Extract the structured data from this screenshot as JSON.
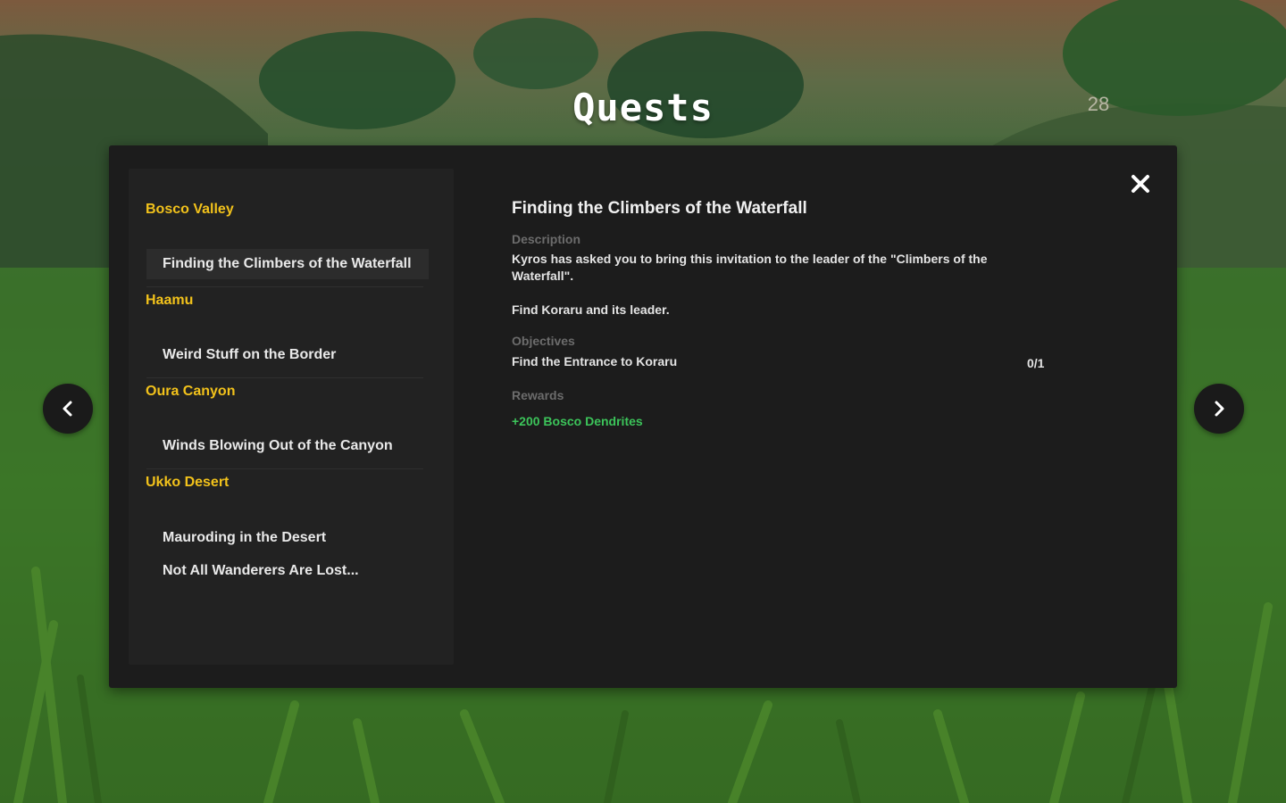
{
  "header": {
    "title": "Quests",
    "counter": "28"
  },
  "quest_list": {
    "regions": [
      {
        "name": "Bosco Valley",
        "quests": [
          {
            "title": "Finding the Climbers of the Waterfall",
            "selected": true
          }
        ]
      },
      {
        "name": "Haamu",
        "quests": [
          {
            "title": "Weird Stuff on the Border",
            "selected": false
          }
        ]
      },
      {
        "name": "Oura Canyon",
        "quests": [
          {
            "title": "Winds Blowing Out of the Canyon",
            "selected": false
          }
        ]
      },
      {
        "name": "Ukko Desert",
        "quests": [
          {
            "title": "Mauroding in the Desert",
            "selected": false
          },
          {
            "title": "Not All Wanderers Are Lost...",
            "selected": false
          }
        ]
      }
    ]
  },
  "detail": {
    "title": "Finding the Climbers of the Waterfall",
    "description_label": "Description",
    "description_lines": [
      "Kyros has asked you to bring this invitation to the leader of the \"Climbers of the",
      "Waterfall\"."
    ],
    "description_extra": "Find Koraru and its leader.",
    "objectives_label": "Objectives",
    "objective": {
      "text": "Find the Entrance to Koraru",
      "progress": "0/1"
    },
    "rewards_label": "Rewards",
    "reward": "+200 Bosco Dendrites"
  },
  "icons": {
    "close": "close-icon",
    "prev": "chevron-left-icon",
    "next": "chevron-right-icon"
  },
  "colors": {
    "region_heading": "#f2c21b",
    "reward": "#3cc45a",
    "panel": "#1c1c1c"
  }
}
